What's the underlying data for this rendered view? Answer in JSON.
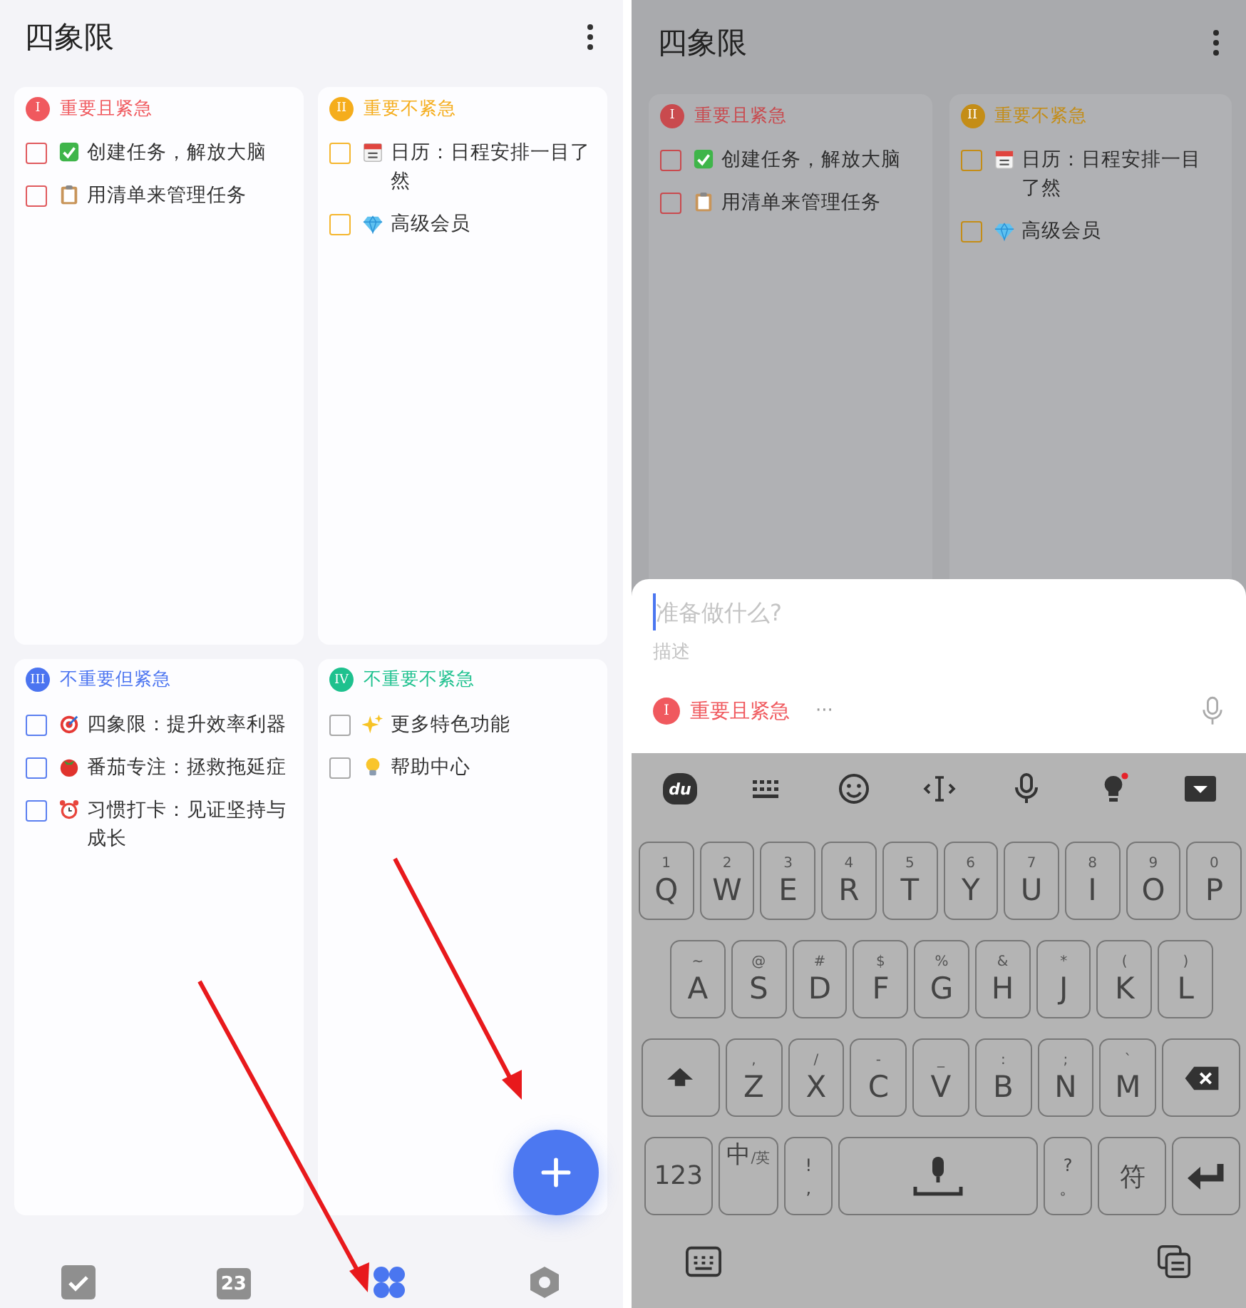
{
  "left_screen": {
    "title": "四象限",
    "quadrants": [
      {
        "numeral": "I",
        "title": "重要且紧急",
        "color": "#f0595e",
        "items": [
          {
            "text": "创建任务，解放大脑",
            "checked": false,
            "color": "#e05a5e"
          },
          {
            "text": "用清单来管理任务",
            "checked": false,
            "color": "#e05a5e"
          }
        ]
      },
      {
        "numeral": "II",
        "title": "重要不紧急",
        "color": "#f5ad1c",
        "items": [
          {
            "text": "日历：日程安排一目了然",
            "checked": false,
            "color": "#f5b62e"
          },
          {
            "text": "高级会员",
            "checked": false,
            "color": "#f5b62e"
          }
        ]
      },
      {
        "numeral": "III",
        "title": "不重要但紧急",
        "color": "#4b74f0",
        "items": [
          {
            "text": "四象限：提升效率利器",
            "checked": false,
            "color": "#5b7ff0"
          },
          {
            "text": "番茄专注：拯救拖延症",
            "checked": false,
            "color": "#5b7ff0"
          },
          {
            "text": "习惯打卡：见证坚持与成长",
            "checked": false,
            "color": "#5b7ff0"
          }
        ]
      },
      {
        "numeral": "IV",
        "title": "不重要不紧急",
        "color": "#1ec18e",
        "items": [
          {
            "text": "更多特色功能",
            "checked": false,
            "color": "#a8a8a8"
          },
          {
            "text": "帮助中心",
            "checked": false,
            "color": "#a8a8a8"
          }
        ]
      }
    ],
    "nav": [
      {
        "kind": "tasks",
        "selected": false
      },
      {
        "kind": "calendar",
        "label": "23",
        "selected": false
      },
      {
        "kind": "quadrant",
        "selected": true
      },
      {
        "kind": "settings",
        "selected": false
      }
    ]
  },
  "right_screen": {
    "title": "四象限",
    "quadrants": [
      {
        "numeral": "I",
        "title": "重要且紧急",
        "color": "#c94a4e",
        "items": [
          {
            "text": "创建任务，解放大脑",
            "checked": false
          },
          {
            "text": "用清单来管理任务",
            "checked": false
          }
        ]
      },
      {
        "numeral": "II",
        "title": "重要不紧急",
        "color": "#c48d17",
        "items": [
          {
            "text": "日历：日程安排一目了然",
            "checked": false
          },
          {
            "text": "高级会员",
            "checked": false
          }
        ]
      }
    ],
    "new_task": {
      "title_placeholder": "准备做什么?",
      "description_placeholder": "描述",
      "priority_numeral": "I",
      "priority": "重要且紧急",
      "more": "···"
    },
    "keyboard": {
      "logo": "du",
      "rows": [
        {
          "keys": [
            {
              "kind": "letter",
              "label": "Q",
              "hint": "1"
            },
            {
              "kind": "letter",
              "label": "W",
              "hint": "2"
            },
            {
              "kind": "letter",
              "label": "E",
              "hint": "3"
            },
            {
              "kind": "letter",
              "label": "R",
              "hint": "4"
            },
            {
              "kind": "letter",
              "label": "T",
              "hint": "5"
            },
            {
              "kind": "letter",
              "label": "Y",
              "hint": "6"
            },
            {
              "kind": "letter",
              "label": "U",
              "hint": "7"
            },
            {
              "kind": "letter",
              "label": "I",
              "hint": "8"
            },
            {
              "kind": "letter",
              "label": "O",
              "hint": "9"
            },
            {
              "kind": "letter",
              "label": "P",
              "hint": "0"
            }
          ]
        },
        {
          "keys": [
            {
              "kind": "letter",
              "label": "A",
              "hint": "~"
            },
            {
              "kind": "letter",
              "label": "S",
              "hint": "@"
            },
            {
              "kind": "letter",
              "label": "D",
              "hint": "#"
            },
            {
              "kind": "letter",
              "label": "F",
              "hint": "$"
            },
            {
              "kind": "letter",
              "label": "G",
              "hint": "%"
            },
            {
              "kind": "letter",
              "label": "H",
              "hint": "&"
            },
            {
              "kind": "letter",
              "label": "J",
              "hint": "*"
            },
            {
              "kind": "letter",
              "label": "K",
              "hint": "("
            },
            {
              "kind": "letter",
              "label": "L",
              "hint": ")"
            }
          ]
        },
        {
          "keys": [
            {
              "kind": "shift"
            },
            {
              "kind": "letter",
              "label": "Z",
              "hint": ","
            },
            {
              "kind": "letter",
              "label": "X",
              "hint": "/"
            },
            {
              "kind": "letter",
              "label": "C",
              "hint": "-"
            },
            {
              "kind": "letter",
              "label": "V",
              "hint": "_"
            },
            {
              "kind": "letter",
              "label": "B",
              "hint": ":"
            },
            {
              "kind": "letter",
              "label": "N",
              "hint": ";"
            },
            {
              "kind": "letter",
              "label": "M",
              "hint": "`"
            },
            {
              "kind": "backspace"
            }
          ]
        },
        {
          "keys": [
            {
              "kind": "text",
              "label": "123"
            },
            {
              "kind": "lang",
              "label": "中",
              "hint": "/英"
            },
            {
              "kind": "punct",
              "label": ",",
              "hint": "!"
            },
            {
              "kind": "space"
            },
            {
              "kind": "punct",
              "label": "。",
              "hint": "?"
            },
            {
              "kind": "text",
              "label": "符"
            },
            {
              "kind": "enter"
            }
          ]
        }
      ]
    }
  }
}
